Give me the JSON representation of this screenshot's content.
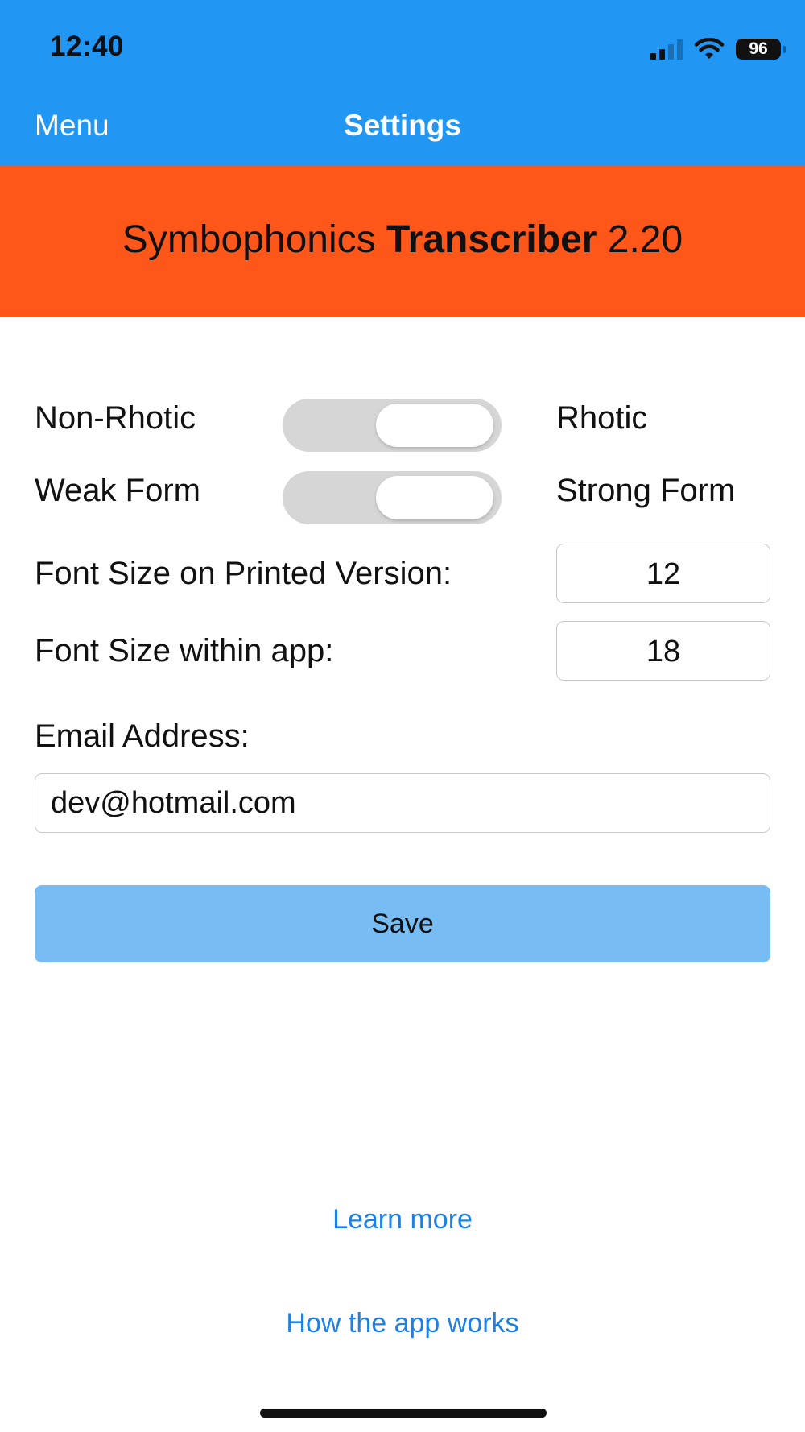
{
  "status_bar": {
    "time": "12:40",
    "battery": "96"
  },
  "nav": {
    "menu_label": "Menu",
    "title": "Settings"
  },
  "banner": {
    "part1": "Symbophonics ",
    "part2_bold": "Transcriber",
    "part3": " 2.20"
  },
  "settings": {
    "rhotic": {
      "left_label": "Non-Rhotic",
      "right_label": "Rhotic"
    },
    "form": {
      "left_label": "Weak Form",
      "right_label": "Strong Form"
    },
    "printed_font": {
      "label": "Font Size on Printed Version:",
      "value": "12"
    },
    "app_font": {
      "label": "Font Size within app:",
      "value": "18"
    },
    "email": {
      "label": "Email Address:",
      "value": "dev@hotmail.com"
    },
    "save_label": "Save"
  },
  "links": {
    "learn_more": "Learn more",
    "how_it_works": "How the app works"
  },
  "colors": {
    "nav_bg": "#2296F3",
    "banner_bg": "#FE5719",
    "save_bg": "#77BCF3",
    "link": "#1E7FE4"
  }
}
